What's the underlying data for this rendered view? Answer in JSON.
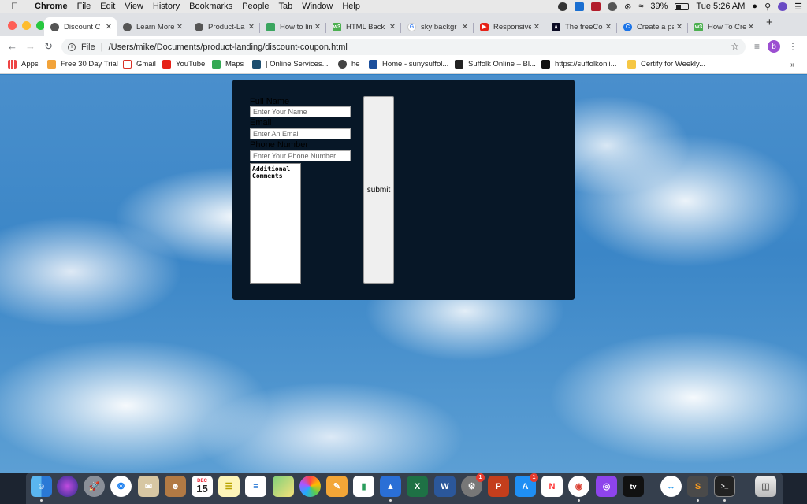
{
  "menubar": {
    "app": "Chrome",
    "items": [
      "File",
      "Edit",
      "View",
      "History",
      "Bookmarks",
      "People",
      "Tab",
      "Window",
      "Help"
    ],
    "battery": "39%",
    "clock": "Tue 5:26 AM"
  },
  "tabs": [
    {
      "label": "Discount C",
      "favicon": "globe-icon",
      "active": true
    },
    {
      "label": "Learn More",
      "favicon": "globe-icon"
    },
    {
      "label": "Product-La",
      "favicon": "globe-icon"
    },
    {
      "label": "How to link",
      "favicon": "codepen-icon"
    },
    {
      "label": "HTML Back",
      "favicon": "w3schools-icon"
    },
    {
      "label": "sky backgr",
      "favicon": "google-icon"
    },
    {
      "label": "Responsive",
      "favicon": "youtube-icon"
    },
    {
      "label": "The freeCo",
      "favicon": "freecodecamp-icon"
    },
    {
      "label": "Create a pa",
      "favicon": "chrome-icon"
    },
    {
      "label": "How To Cre",
      "favicon": "w3schools-icon"
    }
  ],
  "address": {
    "scheme_label": "File",
    "url": "/Users/mike/Documents/product-landing/discount-coupon.html"
  },
  "profile_initial": "b",
  "bookmarks": [
    {
      "label": "Apps",
      "icon": "apps-grid-icon"
    },
    {
      "label": "Free 30 Day Trial",
      "icon": "bookmark-icon"
    },
    {
      "label": "Gmail",
      "icon": "gmail-icon"
    },
    {
      "label": "YouTube",
      "icon": "youtube-icon"
    },
    {
      "label": "Maps",
      "icon": "maps-icon"
    },
    {
      "label": "| Online Services...",
      "icon": "bookmark-icon"
    },
    {
      "label": "he",
      "icon": "globe-icon"
    },
    {
      "label": "Home - sunysuffol...",
      "icon": "bookmark-icon"
    },
    {
      "label": "Suffolk Online – Bl...",
      "icon": "blackboard-icon"
    },
    {
      "label": "https://suffolkonli...",
      "icon": "blackboard-icon"
    },
    {
      "label": "Certify for Weekly...",
      "icon": "bookmark-icon"
    }
  ],
  "form": {
    "name_label": "Full Name",
    "name_placeholder": "Enter Your Name",
    "email_label": "Email",
    "email_placeholder": "Enter An Email",
    "phone_label": "Phone Number",
    "phone_placeholder": "Enter Your Phone Number",
    "comments_placeholder": "Additional Comments",
    "submit_label": "submit"
  },
  "dock": {
    "calendar_month": "DEC",
    "calendar_day": "15",
    "badges": {
      "system-preferences": "1",
      "app-store": "1"
    }
  },
  "colors": {
    "form_background": "#071727",
    "tabstrip": "#dfe1e5"
  }
}
